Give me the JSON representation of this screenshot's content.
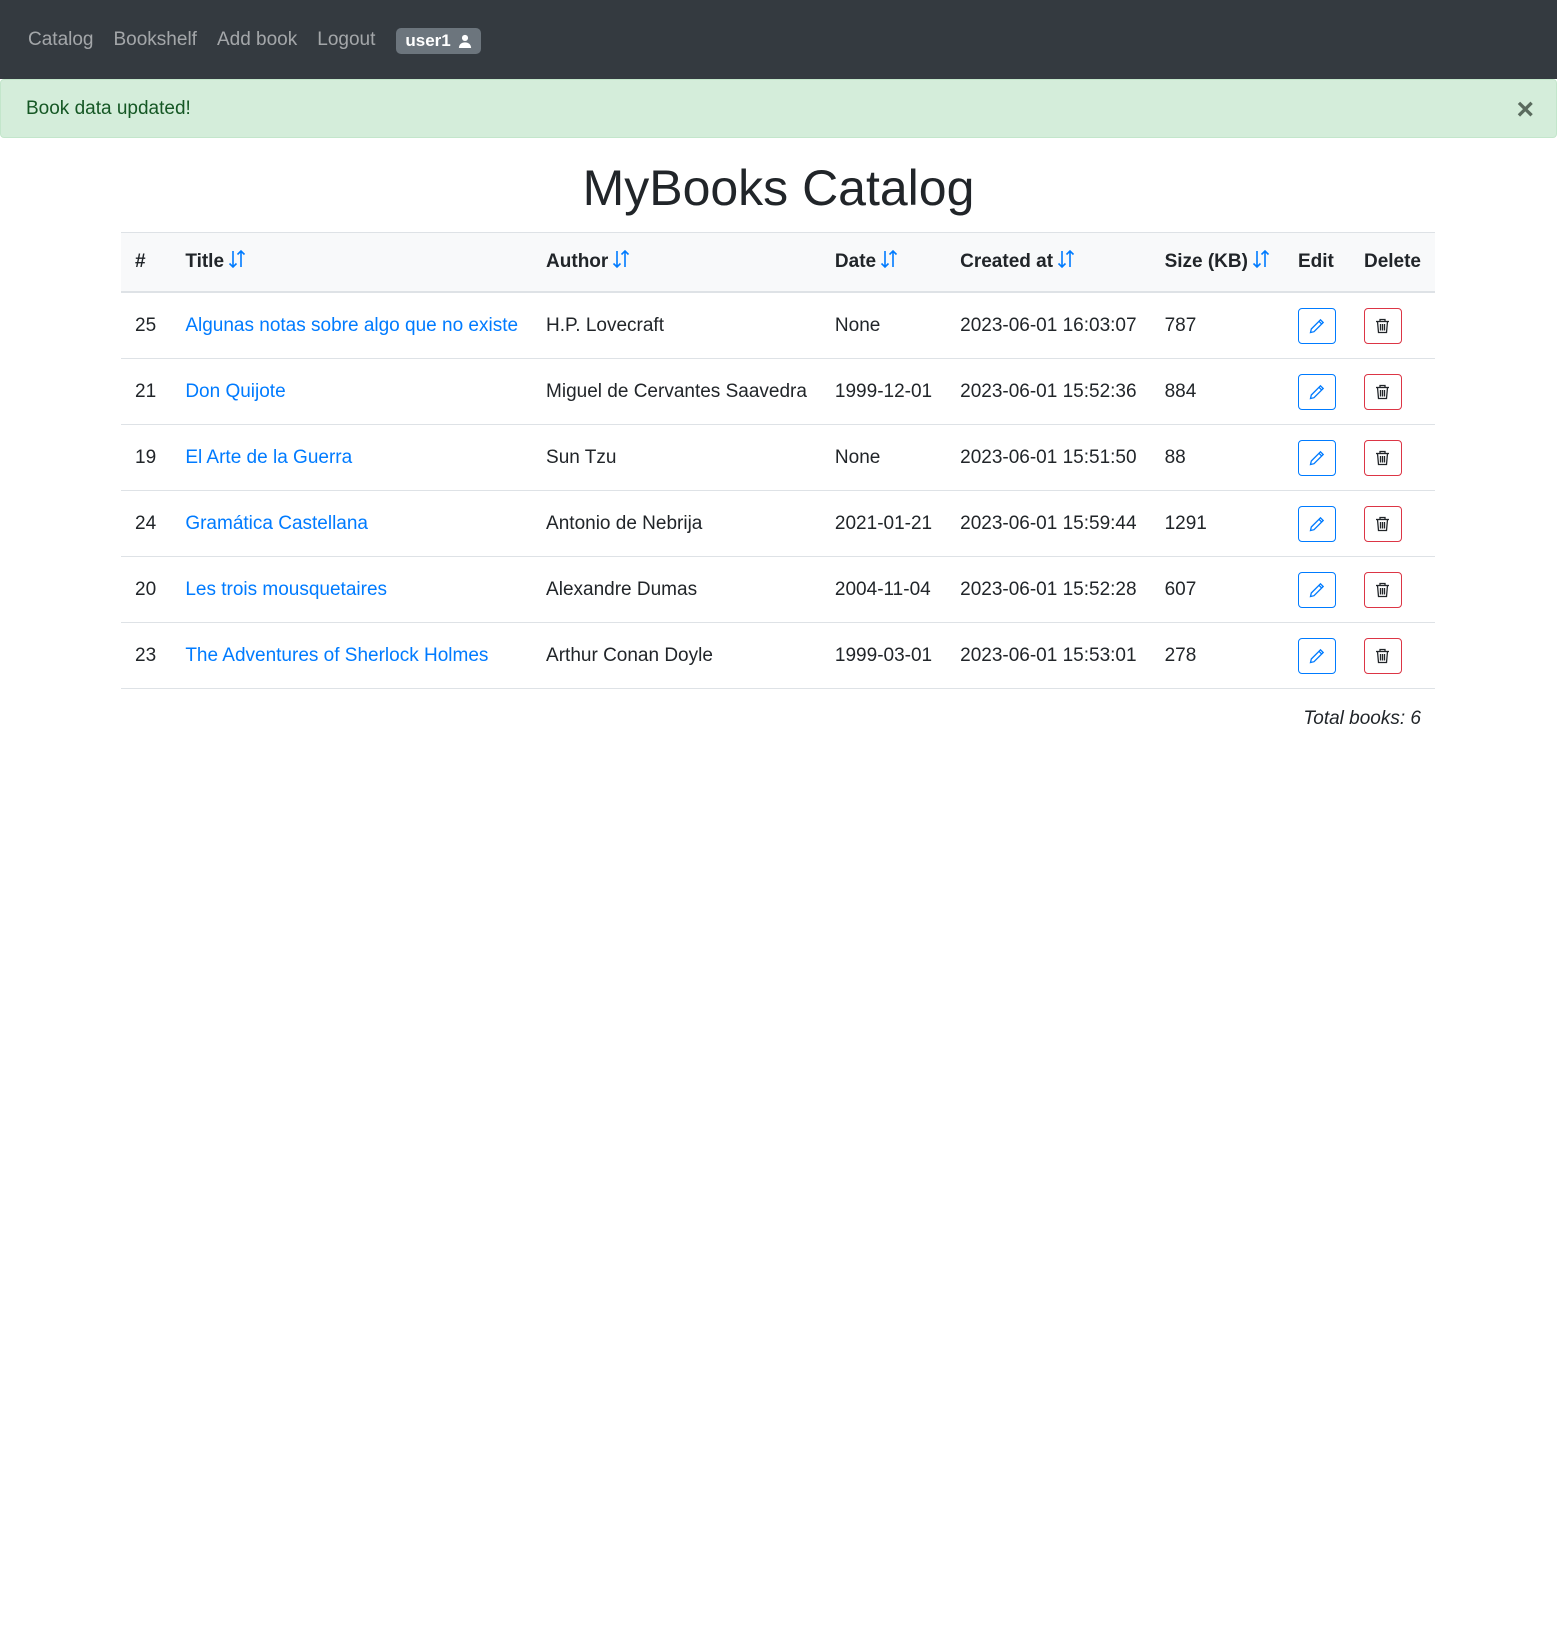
{
  "nav": {
    "catalog": "Catalog",
    "bookshelf": "Bookshelf",
    "add_book": "Add book",
    "logout": "Logout",
    "user": "user1"
  },
  "alert": {
    "message": "Book data updated!",
    "close": "×"
  },
  "page_title": "MyBooks Catalog",
  "table": {
    "headers": [
      "#",
      "Title",
      "Author",
      "Date",
      "Created at",
      "Size (KB)",
      "Edit",
      "Delete"
    ],
    "rows": [
      {
        "id": "25",
        "title": "Algunas notas sobre algo que no existe",
        "author": "H.P. Lovecraft",
        "date": "None",
        "created": "2023-06-01 16:03:07",
        "size": "787"
      },
      {
        "id": "21",
        "title": "Don Quijote",
        "author": "Miguel de Cervantes Saavedra",
        "date": "1999-12-01",
        "created": "2023-06-01 15:52:36",
        "size": "884"
      },
      {
        "id": "19",
        "title": "El Arte de la Guerra",
        "author": "Sun Tzu",
        "date": "None",
        "created": "2023-06-01 15:51:50",
        "size": "88"
      },
      {
        "id": "24",
        "title": "Gramática Castellana",
        "author": "Antonio de Nebrija",
        "date": "2021-01-21",
        "created": "2023-06-01 15:59:44",
        "size": "1291"
      },
      {
        "id": "20",
        "title": "Les trois mousquetaires",
        "author": "Alexandre Dumas",
        "date": "2004-11-04",
        "created": "2023-06-01 15:52:28",
        "size": "607"
      },
      {
        "id": "23",
        "title": "The Adventures of Sherlock Holmes",
        "author": "Arthur Conan Doyle",
        "date": "1999-03-01",
        "created": "2023-06-01 15:53:01",
        "size": "278"
      }
    ]
  },
  "total": "Total books: 6",
  "icons": {
    "sort": "sort-icon",
    "user": "user-icon",
    "edit": "pencil-icon",
    "delete": "trash-icon"
  },
  "colors": {
    "navbar": "#343a40",
    "link": "#007bff",
    "danger": "#dc3545",
    "alert_bg": "#d4edda",
    "alert_text": "#155724"
  }
}
